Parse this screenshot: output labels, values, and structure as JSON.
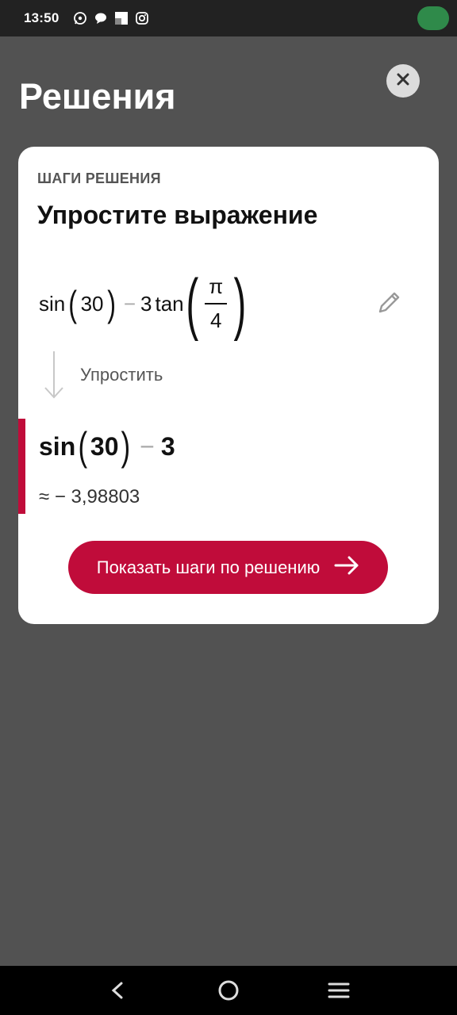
{
  "status_bar": {
    "time": "13:50",
    "icons": [
      "whatsapp-icon",
      "chat-bubble-icon",
      "app-square-icon",
      "instagram-icon"
    ],
    "battery_color": "#2f8a4a"
  },
  "header": {
    "title": "Решения",
    "close_icon": "close-icon"
  },
  "card": {
    "steps_label": "ШАГИ РЕШЕНИЯ",
    "heading": "Упростите выражение",
    "expression": {
      "func1": "sin",
      "arg1": "30",
      "minus": "−",
      "coef": "3",
      "func2": "tan",
      "numerator": "π",
      "denominator": "4"
    },
    "step_label": "Упростить",
    "result": {
      "func": "sin",
      "arg": "30",
      "minus": "−",
      "value": "3"
    },
    "approx": "≈ − 3,98803",
    "cta_label": "Показать шаги по решению"
  },
  "colors": {
    "background": "#525252",
    "accent": "#c00c3a",
    "card": "#ffffff"
  },
  "nav_bar": {
    "buttons": [
      "back-icon",
      "home-icon",
      "menu-icon"
    ]
  }
}
